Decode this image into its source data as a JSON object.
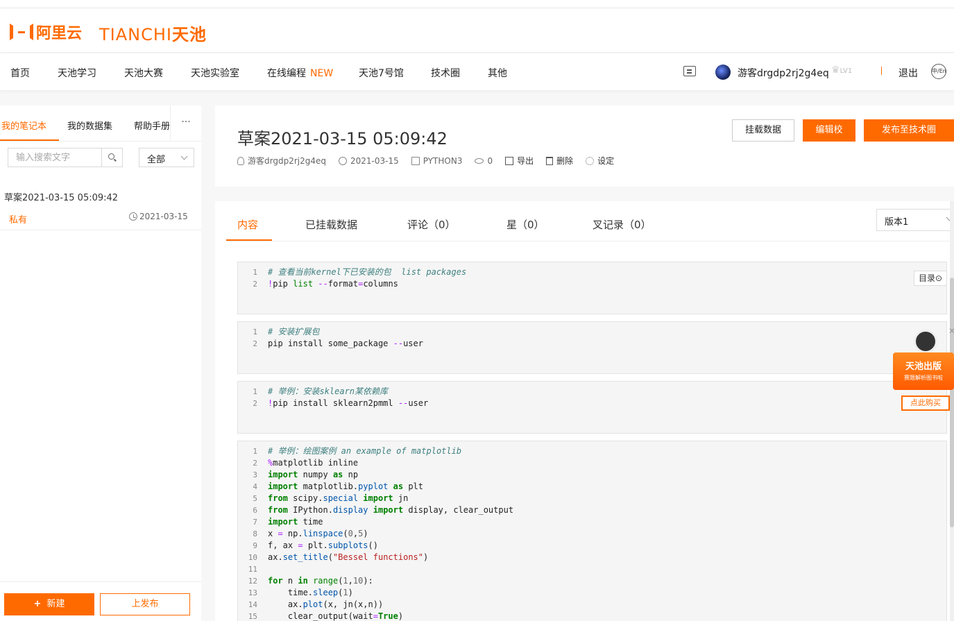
{
  "brand": {
    "aliyun": "阿里云",
    "tianchi_latin": "TIANCHI",
    "tianchi_cn": "天池",
    "accent": "#ff6a00"
  },
  "nav": {
    "items": [
      "首页",
      "天池学习",
      "天池大赛",
      "天池实验室",
      "在线编程",
      "天池7号馆",
      "技术圈",
      "其他"
    ],
    "new_badge": "NEW",
    "username": "游客drgdp2rj2g4eq",
    "level": "LV1",
    "logout": "退出",
    "lang": "中/En"
  },
  "sidebar": {
    "tabs": [
      "我的笔记本",
      "我的数据集",
      "帮助手册"
    ],
    "more": "···",
    "search_placeholder": "输入搜索文字",
    "filter": "全部",
    "note": {
      "title": "草案2021-03-15 05:09:42",
      "visibility": "私有",
      "date": "2021-03-15"
    },
    "new_button": "新建",
    "publish_button": "上发布"
  },
  "notebook": {
    "title": "草案2021-03-15 05:09:42",
    "author": "游客drgdp2rj2g4eq",
    "date": "2021-03-15",
    "kernel": "PYTHON3",
    "views": "0",
    "export": "导出",
    "delete": "删除",
    "settings": "设定",
    "mount_button": "挂载数据",
    "edit_button": "编辑校",
    "post_button": "发布至技术圈"
  },
  "content": {
    "tabs": [
      "内容",
      "已挂载数据",
      "评论（0）",
      "星（0）",
      "叉记录（0）"
    ],
    "version": "版本1",
    "toc": "目录",
    "cells": [
      [
        "# 查看当前kernel下已安装的包  list packages",
        "!pip list --format=columns"
      ],
      [
        "# 安装扩展包",
        "pip install some_package --user"
      ],
      [
        "# 举例：安装sklearn某依赖库",
        "!pip install sklearn2pmml --user"
      ],
      [
        "# 举例：绘图案例 an example of matplotlib",
        "%matplotlib inline",
        "import numpy as np",
        "import matplotlib.pyplot as plt",
        "from scipy.special import jn",
        "from IPython.display import display, clear_output",
        "import time",
        "x = np.linspace(0,5)",
        "f, ax = plt.subplots()",
        "ax.set_title(\"Bessel functions\")",
        "",
        "for n in range(1,10):",
        "    time.sleep(1)",
        "    ax.plot(x, jn(x,n))",
        "    clear_output(wait=True)"
      ]
    ]
  },
  "promo": {
    "title": "天池出版",
    "subtitle": "赛题解析图书啦",
    "buy": "点此购买",
    "close": "✕"
  }
}
